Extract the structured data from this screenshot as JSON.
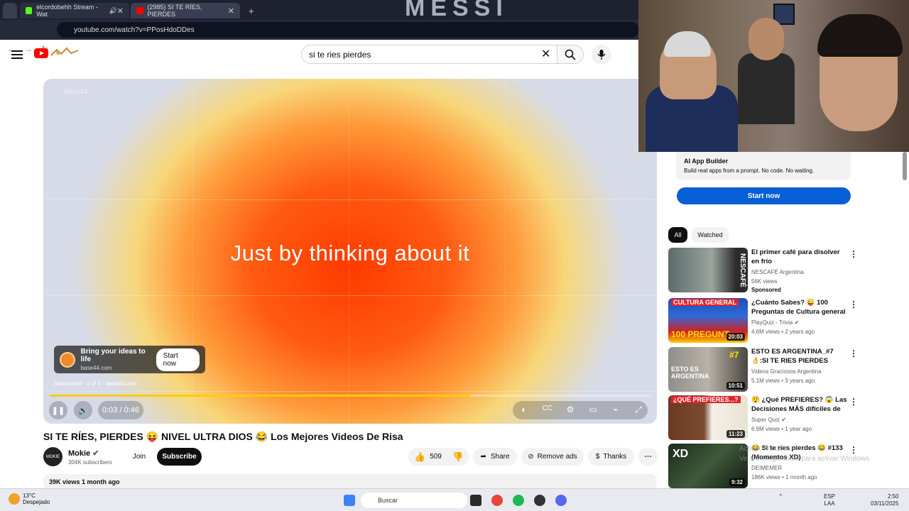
{
  "browser": {
    "tabs": [
      {
        "label": "elcordobehh Stream - Wat"
      },
      {
        "label": "(2985) SI TE RÍES, PIERDES"
      }
    ],
    "url": "youtube.com/watch?v=PPosHdoDDes",
    "banner_text": "MESSI"
  },
  "header": {
    "search_query": "si te ries pierdes"
  },
  "player": {
    "brand_small": "Base44",
    "headline": "Just by thinking about it",
    "ad_title": "Bring your ideas to life",
    "ad_domain": "base44.com",
    "ad_cta": "Start now",
    "sponsored_line": "Sponsored · 1 of 2 · base44.com",
    "time": "0:03 / 0:46",
    "progress": 0.7,
    "colors": {
      "accent": "#ff3b00",
      "progress": "#ffcc00"
    }
  },
  "video": {
    "title": "SI TE RÍES, PIERDES 😝 NIVEL ULTRA DIOS 😂 Los Mejores Videos De Risa",
    "channel": "Mokie",
    "channel_avatar_text": "MOKIE",
    "subscribers": "304K subscribers",
    "join": "Join",
    "subscribe": "Subscribe",
    "likes": "509",
    "share": "Share",
    "remove_ads": "Remove ads",
    "thanks": "Thanks",
    "views_line": "39K views  1 month ago"
  },
  "sidebar": {
    "ad_title": "AI App Builder",
    "ad_desc": "Build real apps from a prompt. No code. No waiting.",
    "ad_cta": "Start now",
    "chips": [
      "All",
      "Watched"
    ],
    "recs": [
      {
        "title": "El primer café para disolver en frío",
        "channel": "NESCAFÉ Argentina",
        "views": "56K views",
        "extra": "Sponsored",
        "duration": "",
        "thumb_text": "NESCAFÉ"
      },
      {
        "title": "¿Cuánto Sabes? 😜 100 Preguntas de Cultura general ...",
        "channel": "PlayQuiz - Trivia",
        "views": "4.6M views • 2 years ago",
        "extra": "",
        "duration": "20:03",
        "thumb_text": "100 PREGUNT"
      },
      {
        "title": "ESTO ES ARGENTINA_#7 👌:SI TE RIES PIERDES NIVEL ...",
        "channel": "Videos Graciosos Argentina",
        "views": "5.1M views • 3 years ago",
        "extra": "",
        "duration": "10:51",
        "thumb_text": "ESTO ES ARGENTINA"
      },
      {
        "title": "😲 ¿Qué PREFIERES? 😱 Las Decisiones MÁS difíciles de T...",
        "channel": "Super Quiz",
        "views": "6.9M views • 1 year ago",
        "extra": "",
        "duration": "11:23",
        "thumb_text": "¿QUÉ PREFIERES...?"
      },
      {
        "title": "😂 Si te ríes pierdes 😂 #133 (Momentos XD)",
        "channel": "DEIMEMER",
        "views": "186K views • 1 month ago",
        "extra": "",
        "duration": "9:32",
        "thumb_text": "XD"
      }
    ],
    "watermark_line1": "Activar Windows",
    "watermark_line2": "Ve a Configuración para activar Windows."
  },
  "taskbar": {
    "temp": "13°C",
    "weather": "Despejado",
    "search_label": "Buscar",
    "lang1": "ESP",
    "lang2": "LAA",
    "time": "2:50",
    "date": "03/11/2025"
  }
}
